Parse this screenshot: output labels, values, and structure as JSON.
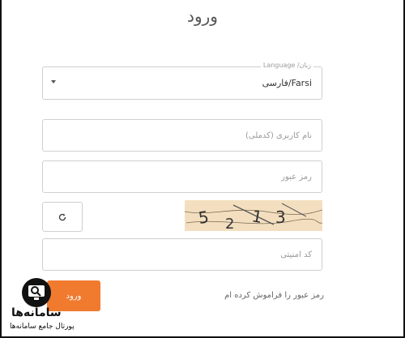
{
  "page": {
    "title": "ورود"
  },
  "form": {
    "language": {
      "legend": "زبان/ Language",
      "value": "فارسی/Farsi"
    },
    "username": {
      "placeholder": "نام کاربری (کدملی)"
    },
    "password": {
      "placeholder": "رمز عبور"
    },
    "captcha": {
      "text": "5 2 1 3",
      "digits": [
        "5",
        "2",
        "1",
        "3"
      ]
    },
    "security_code": {
      "placeholder": "کد امنیتی"
    },
    "submit_label": "ورود",
    "forgot_password": "رمز عبور را فراموش کرده ام"
  },
  "watermark": {
    "name": "سامانه‌ها",
    "tagline": "پورتال جامع سامانه‌ها"
  },
  "colors": {
    "accent": "#f07a2e",
    "captcha_bg": "#f3dfbf"
  }
}
